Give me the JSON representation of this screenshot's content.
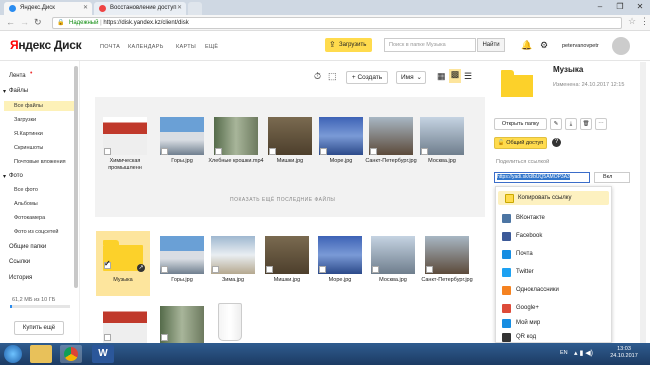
{
  "browser": {
    "tabs": [
      {
        "title": "Яндекс.Диск"
      },
      {
        "title": "Восстановление доступ"
      }
    ],
    "address_secure": "Надежный",
    "address_url": "https://disk.yandex.kz/client/disk",
    "window_controls": [
      "–",
      "❐",
      "✕"
    ]
  },
  "header": {
    "logo_y": "Я",
    "logo_rest": "ндекс Диск",
    "nav": [
      "ПОЧТА",
      "КАЛЕНДАРЬ",
      "КАРТЫ",
      "ЕЩЁ"
    ],
    "upload_label": "Загрузить",
    "search_placeholder": "Поиск в папке Музыка",
    "find_label": "Найти",
    "username": "petervanovpetr"
  },
  "sidebar": {
    "feed": "Лента",
    "files": "Файлы",
    "all_files": "Все файлы",
    "downloads": "Загрузки",
    "pictures": "Я.Картинки",
    "screenshots": "Скриншоты",
    "mail_attachments": "Почтовые вложения",
    "photos": "Фото",
    "all_photos": "Все фото",
    "albums": "Альбомы",
    "camera": "Фотокамера",
    "social_photos": "Фото из соцсетей",
    "shared": "Общие папки",
    "links": "Ссылки",
    "history": "История",
    "quota": "61,2 МБ из 10 ГБ",
    "buy_more": "Купить ещё"
  },
  "toolbar": {
    "create_label": "Создать",
    "sort_label": "Имя"
  },
  "recent": {
    "items": [
      {
        "caption": "Химическая промышленн"
      },
      {
        "caption": "Горы.jpg"
      },
      {
        "caption": "Хлебные крошки.mp4"
      },
      {
        "caption": "Мишки.jpg"
      },
      {
        "caption": "Море.jpg"
      },
      {
        "caption": "Санкт-Петербург.jpg"
      },
      {
        "caption": "Москва.jpg"
      }
    ],
    "show_more": "ПОКАЗАТЬ ЕЩЁ ПОСЛЕДНИЕ ФАЙЛЫ"
  },
  "files": {
    "items": [
      {
        "caption": "Музыка"
      },
      {
        "caption": "Горы.jpg"
      },
      {
        "caption": "Зима.jpg"
      },
      {
        "caption": "Мишки.jpg"
      },
      {
        "caption": "Море.jpg"
      },
      {
        "caption": "Москва.jpg"
      },
      {
        "caption": "Санкт-Петербург.jpg"
      }
    ]
  },
  "details": {
    "title": "Музыка",
    "date": "Изменена: 24.10.2017 12:15",
    "open_folder": "Открыть папку",
    "public_access": "Общий доступ",
    "share_link_label": "Поделиться ссылкой",
    "share_link": "https://yadi.sk/d/bUQ5AMOP3A3",
    "toggle_label": "Вкл",
    "share_menu": [
      {
        "label": "Копировать ссылку",
        "color": "#ffdb4d"
      },
      {
        "label": "ВКонтакте",
        "color": "#4c75a3"
      },
      {
        "label": "Facebook",
        "color": "#3b5998"
      },
      {
        "label": "Почта",
        "color": "#168de2"
      },
      {
        "label": "Twitter",
        "color": "#1da1f2"
      },
      {
        "label": "Одноклассники",
        "color": "#f58220"
      },
      {
        "label": "Google+",
        "color": "#dd4b39"
      },
      {
        "label": "Мой мир",
        "color": "#168de2"
      },
      {
        "label": "QR код",
        "color": "#333333"
      }
    ]
  },
  "taskbar": {
    "lang": "EN",
    "time": "13:03",
    "date": "24.10.2017"
  }
}
